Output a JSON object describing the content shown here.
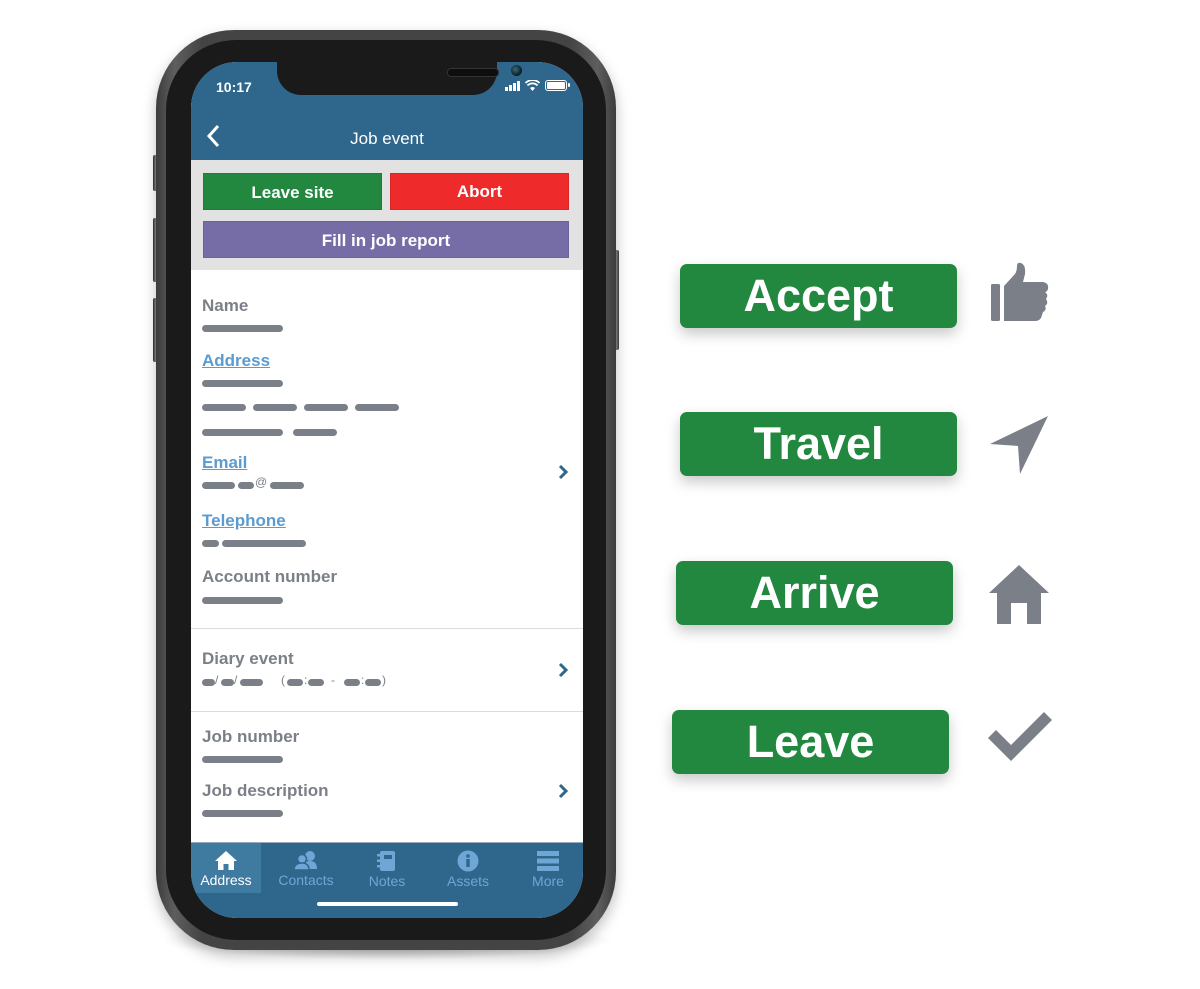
{
  "status_bar": {
    "time": "10:17"
  },
  "header": {
    "title": "Job event",
    "back_icon": "chevron-left-icon"
  },
  "actions": {
    "leave_site": {
      "label": "Leave site",
      "color": "#228840"
    },
    "abort": {
      "label": "Abort",
      "color": "#ee2a2a"
    },
    "fill_report": {
      "label": "Fill in job report",
      "color": "#766ca6"
    }
  },
  "details": {
    "name_label": "Name",
    "address_label": "Address",
    "email_label": "Email",
    "email_at": "@",
    "telephone_label": "Telephone",
    "account_label": "Account number",
    "diary_label": "Diary event",
    "diary_sep_1": "/",
    "diary_sep_2": "/",
    "diary_open": "(",
    "diary_colon_1": ":",
    "diary_dash": "-",
    "diary_colon_2": ":",
    "diary_close": ")",
    "job_number_label": "Job number",
    "job_description_label": "Job description",
    "link_color": "#5b9bd0"
  },
  "tabbar": {
    "items": [
      {
        "label": "Address",
        "icon": "home-icon",
        "active": true
      },
      {
        "label": "Contacts",
        "icon": "contacts-icon",
        "active": false
      },
      {
        "label": "Notes",
        "icon": "notebook-icon",
        "active": false
      },
      {
        "label": "Assets",
        "icon": "info-icon",
        "active": false
      },
      {
        "label": "More",
        "icon": "menu-icon",
        "active": false
      }
    ]
  },
  "status_steps": [
    {
      "label": "Accept",
      "icon": "thumbs-up-icon"
    },
    {
      "label": "Travel",
      "icon": "navigation-arrow-icon"
    },
    {
      "label": "Arrive",
      "icon": "home-icon"
    },
    {
      "label": "Leave",
      "icon": "checkmark-icon"
    }
  ],
  "colors": {
    "brand_blue": "#2e668c",
    "step_green": "#228840",
    "icon_gray": "#7b8088"
  }
}
